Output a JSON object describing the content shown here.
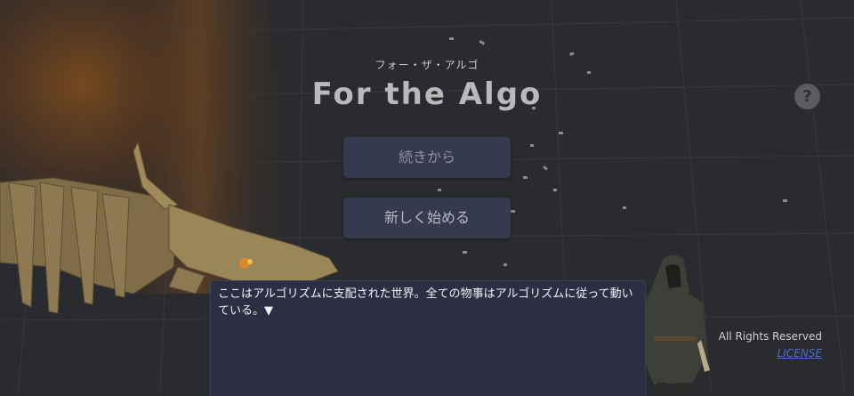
{
  "header": {
    "subtitle": "フォー・ザ・アルゴ",
    "title": "For the Algo",
    "help_label": "?"
  },
  "menu": {
    "continue_label": "続きから",
    "new_game_label": "新しく始める"
  },
  "dialog": {
    "text": "ここはアルゴリズムに支配された世界。全ての物事はアルゴリズムに従って動いている。▼"
  },
  "footer": {
    "rights": "All Rights Reserved",
    "license": "LICENSE"
  },
  "colors": {
    "background": "#2a2b2f",
    "button": "#353a4f",
    "dialog": "#2c2f43",
    "link": "#4d6fc8"
  }
}
